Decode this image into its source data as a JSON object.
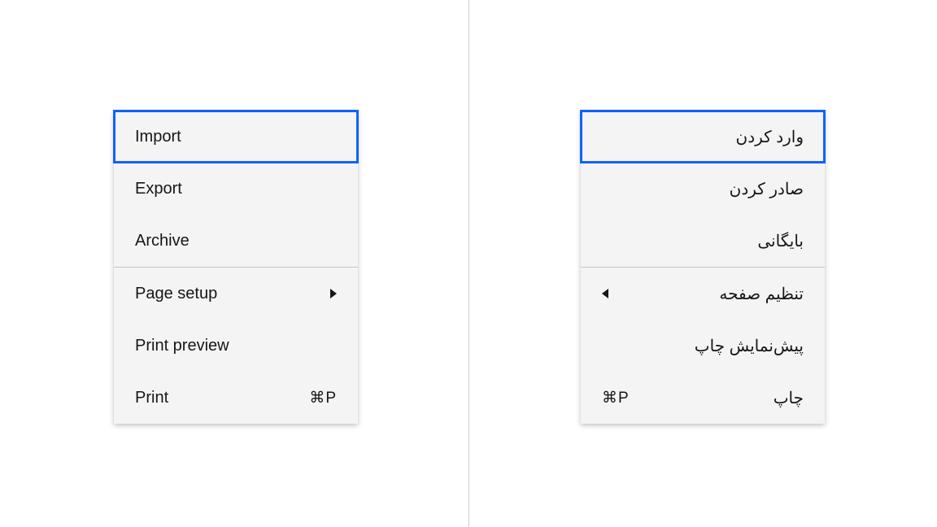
{
  "left_menu": {
    "items": [
      {
        "label": "Import"
      },
      {
        "label": "Export"
      },
      {
        "label": "Archive"
      },
      {
        "label": "Page setup"
      },
      {
        "label": "Print preview"
      },
      {
        "label": "Print",
        "shortcut": "⌘P"
      }
    ]
  },
  "right_menu": {
    "items": [
      {
        "label": "وارد کردن"
      },
      {
        "label": "صادر کردن"
      },
      {
        "label": "بایگانی"
      },
      {
        "label": "تنظیم صفحه"
      },
      {
        "label": "پیش‌نمایش چاپ"
      },
      {
        "label": "چاپ",
        "shortcut": "⌘P"
      }
    ]
  }
}
